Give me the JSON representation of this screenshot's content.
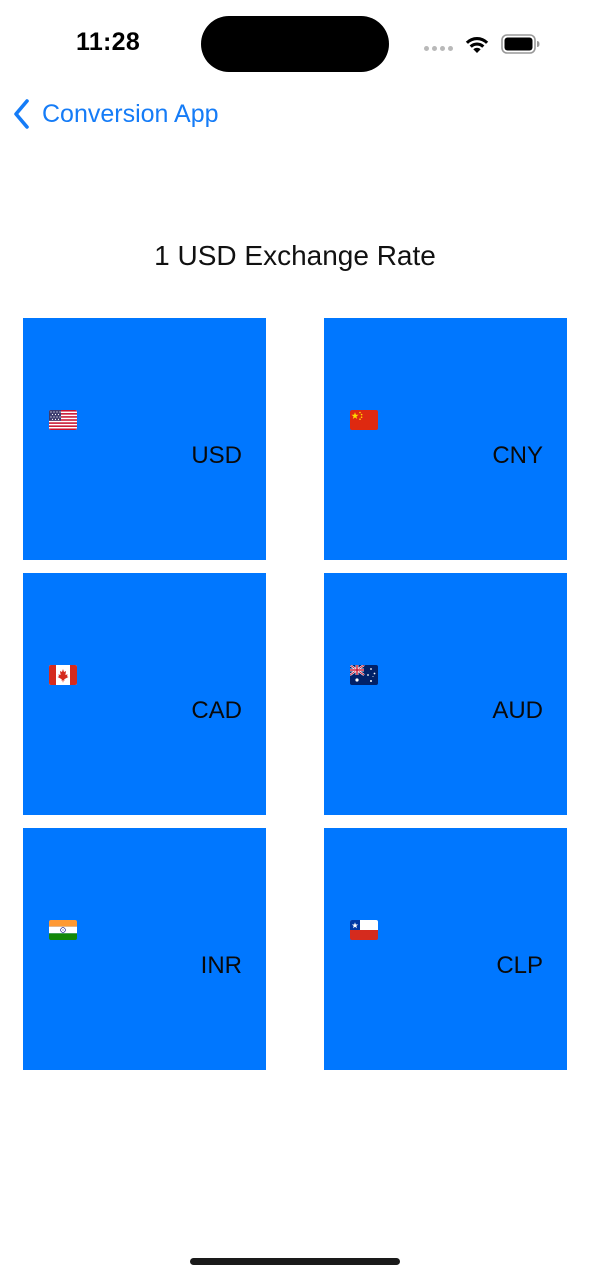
{
  "status_bar": {
    "time": "11:28"
  },
  "nav": {
    "back_label": "Conversion App",
    "back_icon": "chevron-left-icon"
  },
  "page": {
    "title": "1 USD Exchange Rate"
  },
  "currencies": [
    {
      "code": "USD",
      "flag": "us-flag-icon"
    },
    {
      "code": "CNY",
      "flag": "china-flag-icon"
    },
    {
      "code": "CAD",
      "flag": "canada-flag-icon"
    },
    {
      "code": "AUD",
      "flag": "australia-flag-icon"
    },
    {
      "code": "INR",
      "flag": "india-flag-icon"
    },
    {
      "code": "CLP",
      "flag": "chile-flag-icon"
    }
  ],
  "colors": {
    "accent": "#157cf7",
    "tile": "#0077ff",
    "background": "#ffffff"
  }
}
